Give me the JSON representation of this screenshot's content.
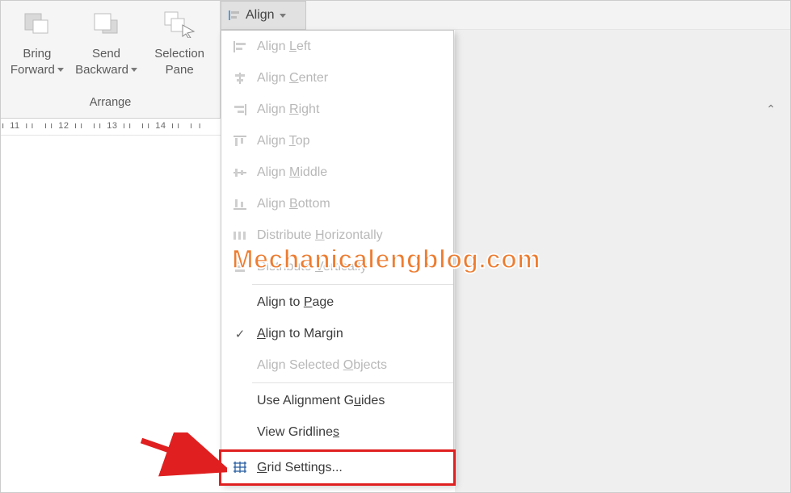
{
  "ribbon": {
    "group_label": "Arrange",
    "bring_forward": "Bring\nForward",
    "send_backward": "Send\nBackward",
    "selection_pane": "Selection\nPane"
  },
  "align_button": {
    "label": "Align"
  },
  "ruler": {
    "marks": [
      "11",
      "12",
      "13",
      "14"
    ]
  },
  "menu": {
    "items": [
      {
        "key": "align-left",
        "label_pre": "Align ",
        "u": "L",
        "label_post": "eft",
        "enabled": false,
        "icon": "align-left"
      },
      {
        "key": "align-center",
        "label_pre": "Align ",
        "u": "C",
        "label_post": "enter",
        "enabled": false,
        "icon": "align-center"
      },
      {
        "key": "align-right",
        "label_pre": "Align ",
        "u": "R",
        "label_post": "ight",
        "enabled": false,
        "icon": "align-right"
      },
      {
        "key": "align-top",
        "label_pre": "Align ",
        "u": "T",
        "label_post": "op",
        "enabled": false,
        "icon": "align-top"
      },
      {
        "key": "align-middle",
        "label_pre": "Align ",
        "u": "M",
        "label_post": "iddle",
        "enabled": false,
        "icon": "align-middle"
      },
      {
        "key": "align-bottom",
        "label_pre": "Align ",
        "u": "B",
        "label_post": "ottom",
        "enabled": false,
        "icon": "align-bottom"
      },
      {
        "key": "dist-horiz",
        "label_pre": "Distribute ",
        "u": "H",
        "label_post": "orizontally",
        "enabled": false,
        "icon": "dist-h"
      },
      {
        "key": "dist-vert",
        "label_pre": "Distribute ",
        "u": "V",
        "label_post": "ertically",
        "enabled": false,
        "icon": "dist-v"
      }
    ],
    "items2": [
      {
        "key": "align-page",
        "label_pre": "Align to ",
        "u": "P",
        "label_post": "age",
        "enabled": true,
        "check": false
      },
      {
        "key": "align-margin",
        "label_pre": "",
        "u": "A",
        "label_post": "lign to Margin",
        "enabled": true,
        "check": true
      },
      {
        "key": "align-objs",
        "label_pre": "Align Selected ",
        "u": "O",
        "label_post": "bjects",
        "enabled": false,
        "check": false
      }
    ],
    "items3": [
      {
        "key": "use-guides",
        "label_pre": "Use Alignment G",
        "u": "u",
        "label_post": "ides",
        "enabled": true
      },
      {
        "key": "view-grid",
        "label_pre": "View Gridline",
        "u": "s",
        "label_post": "",
        "enabled": true
      }
    ],
    "items4": [
      {
        "key": "grid-settings",
        "label_pre": "",
        "u": "G",
        "label_post": "rid Settings...",
        "enabled": true,
        "icon": "grid",
        "highlight": true
      }
    ]
  },
  "watermark": "Mechanicalengblog.com",
  "collapse_caret": "⌃"
}
